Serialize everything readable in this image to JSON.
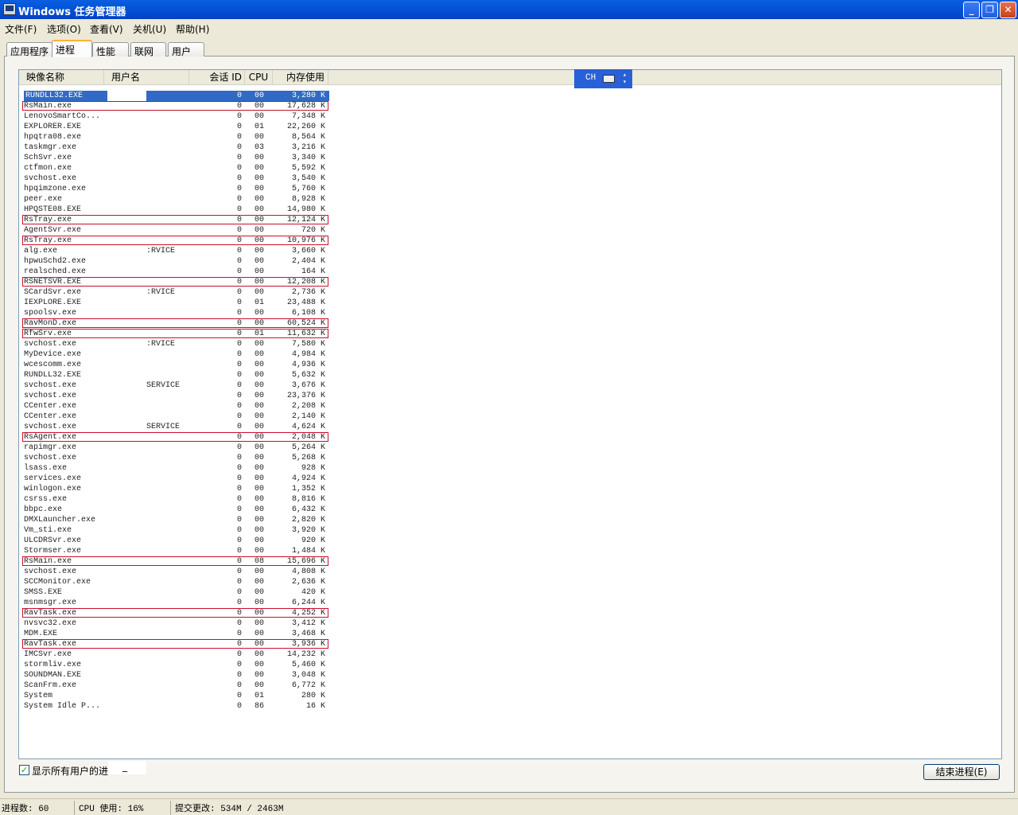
{
  "window": {
    "title": "Windows 任务管理器",
    "minimize": "_",
    "restore": "❐",
    "close": "✕"
  },
  "menu": [
    "文件(F)",
    "选项(O)",
    "查看(V)",
    "关机(U)",
    "帮助(H)"
  ],
  "tabs": [
    {
      "label": "应用程序"
    },
    {
      "label": "进程",
      "active": true
    },
    {
      "label": "性能"
    },
    {
      "label": "联网"
    },
    {
      "label": "用户"
    }
  ],
  "columns": {
    "name": "映像名称",
    "user": "用户名",
    "session": "会话 ID",
    "cpu": "CPU",
    "mem": "内存使用"
  },
  "ime": {
    "lang": "CH"
  },
  "processes": [
    {
      "name": "RUNDLL32.EXE",
      "user": "",
      "session": "0",
      "cpu": "00",
      "mem": "3,280 K",
      "selected": true
    },
    {
      "name": "RsMain.exe",
      "user": "",
      "session": "0",
      "cpu": "00",
      "mem": "17,628 K",
      "highlighted": true
    },
    {
      "name": "LenovoSmartCo...",
      "user": "",
      "session": "0",
      "cpu": "00",
      "mem": "7,348 K"
    },
    {
      "name": "EXPLORER.EXE",
      "user": "",
      "session": "0",
      "cpu": "01",
      "mem": "22,260 K"
    },
    {
      "name": "hpqtra08.exe",
      "user": "",
      "session": "0",
      "cpu": "00",
      "mem": "8,564 K"
    },
    {
      "name": "taskmgr.exe",
      "user": "",
      "session": "0",
      "cpu": "03",
      "mem": "3,216 K"
    },
    {
      "name": "SchSvr.exe",
      "user": "",
      "session": "0",
      "cpu": "00",
      "mem": "3,340 K"
    },
    {
      "name": "ctfmon.exe",
      "user": "",
      "session": "0",
      "cpu": "00",
      "mem": "5,592 K"
    },
    {
      "name": "svchost.exe",
      "user": "",
      "session": "0",
      "cpu": "00",
      "mem": "3,540 K"
    },
    {
      "name": "hpqimzone.exe",
      "user": "",
      "session": "0",
      "cpu": "00",
      "mem": "5,760 K"
    },
    {
      "name": "peer.exe",
      "user": "",
      "session": "0",
      "cpu": "00",
      "mem": "8,928 K"
    },
    {
      "name": "HPQSTE08.EXE",
      "user": "",
      "session": "0",
      "cpu": "00",
      "mem": "14,980 K"
    },
    {
      "name": "RsTray.exe",
      "user": "",
      "session": "0",
      "cpu": "00",
      "mem": "12,124 K",
      "highlighted": true
    },
    {
      "name": "AgentSvr.exe",
      "user": "",
      "session": "0",
      "cpu": "00",
      "mem": "720 K"
    },
    {
      "name": "RsTray.exe",
      "user": "",
      "session": "0",
      "cpu": "00",
      "mem": "10,976 K",
      "highlighted": true
    },
    {
      "name": "alg.exe",
      "user": ":RVICE",
      "session": "0",
      "cpu": "00",
      "mem": "3,660 K"
    },
    {
      "name": "hpwuSchd2.exe",
      "user": "",
      "session": "0",
      "cpu": "00",
      "mem": "2,404 K"
    },
    {
      "name": "realsched.exe",
      "user": "",
      "session": "0",
      "cpu": "00",
      "mem": "164 K"
    },
    {
      "name": "RSNETSVR.EXE",
      "user": "",
      "session": "0",
      "cpu": "00",
      "mem": "12,208 K",
      "highlighted": true
    },
    {
      "name": "SCardSvr.exe",
      "user": ":RVICE",
      "session": "0",
      "cpu": "00",
      "mem": "2,736 K"
    },
    {
      "name": "IEXPLORE.EXE",
      "user": "",
      "session": "0",
      "cpu": "01",
      "mem": "23,488 K"
    },
    {
      "name": "spoolsv.exe",
      "user": "",
      "session": "0",
      "cpu": "00",
      "mem": "6,108 K"
    },
    {
      "name": "RavMonD.exe",
      "user": "",
      "session": "0",
      "cpu": "00",
      "mem": "60,524 K",
      "highlighted": true
    },
    {
      "name": "RfwSrv.exe",
      "user": "",
      "session": "0",
      "cpu": "01",
      "mem": "11,632 K",
      "highlighted": true
    },
    {
      "name": "svchost.exe",
      "user": ":RVICE",
      "session": "0",
      "cpu": "00",
      "mem": "7,580 K"
    },
    {
      "name": "MyDevice.exe",
      "user": "",
      "session": "0",
      "cpu": "00",
      "mem": "4,984 K"
    },
    {
      "name": "wcescomm.exe",
      "user": "",
      "session": "0",
      "cpu": "00",
      "mem": "4,936 K"
    },
    {
      "name": "RUNDLL32.EXE",
      "user": "",
      "session": "0",
      "cpu": "00",
      "mem": "5,632 K"
    },
    {
      "name": "svchost.exe",
      "user": "SERVICE",
      "session": "0",
      "cpu": "00",
      "mem": "3,676 K"
    },
    {
      "name": "svchost.exe",
      "user": "",
      "session": "0",
      "cpu": "00",
      "mem": "23,376 K"
    },
    {
      "name": "CCenter.exe",
      "user": "",
      "session": "0",
      "cpu": "00",
      "mem": "2,208 K"
    },
    {
      "name": "CCenter.exe",
      "user": "",
      "session": "0",
      "cpu": "00",
      "mem": "2,140 K"
    },
    {
      "name": "svchost.exe",
      "user": "SERVICE",
      "session": "0",
      "cpu": "00",
      "mem": "4,624 K"
    },
    {
      "name": "RsAgent.exe",
      "user": "",
      "session": "0",
      "cpu": "00",
      "mem": "2,048 K",
      "highlighted": true
    },
    {
      "name": "rapimgr.exe",
      "user": "",
      "session": "0",
      "cpu": "00",
      "mem": "5,264 K"
    },
    {
      "name": "svchost.exe",
      "user": "",
      "session": "0",
      "cpu": "00",
      "mem": "5,268 K"
    },
    {
      "name": "lsass.exe",
      "user": "",
      "session": "0",
      "cpu": "00",
      "mem": "928 K"
    },
    {
      "name": "services.exe",
      "user": "",
      "session": "0",
      "cpu": "00",
      "mem": "4,924 K"
    },
    {
      "name": "winlogon.exe",
      "user": "",
      "session": "0",
      "cpu": "00",
      "mem": "1,352 K"
    },
    {
      "name": "csrss.exe",
      "user": "",
      "session": "0",
      "cpu": "00",
      "mem": "8,816 K"
    },
    {
      "name": "bbpc.exe",
      "user": "",
      "session": "0",
      "cpu": "00",
      "mem": "6,432 K"
    },
    {
      "name": "DMXLauncher.exe",
      "user": "",
      "session": "0",
      "cpu": "00",
      "mem": "2,820 K"
    },
    {
      "name": "Vm_sti.exe",
      "user": "",
      "session": "0",
      "cpu": "00",
      "mem": "3,920 K"
    },
    {
      "name": "ULCDRSvr.exe",
      "user": "",
      "session": "0",
      "cpu": "00",
      "mem": "920 K"
    },
    {
      "name": "Stormser.exe",
      "user": "",
      "session": "0",
      "cpu": "00",
      "mem": "1,484 K"
    },
    {
      "name": "RsMain.exe",
      "user": "",
      "session": "0",
      "cpu": "08",
      "mem": "15,696 K",
      "highlighted": true
    },
    {
      "name": "svchost.exe",
      "user": "",
      "session": "0",
      "cpu": "00",
      "mem": "4,808 K"
    },
    {
      "name": "SCCMonitor.exe",
      "user": "",
      "session": "0",
      "cpu": "00",
      "mem": "2,636 K"
    },
    {
      "name": "SMSS.EXE",
      "user": "",
      "session": "0",
      "cpu": "00",
      "mem": "420 K"
    },
    {
      "name": "msnmsgr.exe",
      "user": "",
      "session": "0",
      "cpu": "00",
      "mem": "6,244 K"
    },
    {
      "name": "RavTask.exe",
      "user": "",
      "session": "0",
      "cpu": "00",
      "mem": "4,252 K",
      "highlighted": true
    },
    {
      "name": "nvsvc32.exe",
      "user": "",
      "session": "0",
      "cpu": "00",
      "mem": "3,412 K"
    },
    {
      "name": "MDM.EXE",
      "user": "",
      "session": "0",
      "cpu": "00",
      "mem": "3,468 K"
    },
    {
      "name": "RavTask.exe",
      "user": "",
      "session": "0",
      "cpu": "00",
      "mem": "3,936 K",
      "highlighted": true
    },
    {
      "name": "IMCSvr.exe",
      "user": "",
      "session": "0",
      "cpu": "00",
      "mem": "14,232 K"
    },
    {
      "name": "stormliv.exe",
      "user": "",
      "session": "0",
      "cpu": "00",
      "mem": "5,460 K"
    },
    {
      "name": "SOUNDMAN.EXE",
      "user": "",
      "session": "0",
      "cpu": "00",
      "mem": "3,048 K"
    },
    {
      "name": "ScanFrm.exe",
      "user": "",
      "session": "0",
      "cpu": "00",
      "mem": "6,772 K"
    },
    {
      "name": "System",
      "user": "",
      "session": "0",
      "cpu": "01",
      "mem": "280 K"
    },
    {
      "name": "System Idle P...",
      "user": "",
      "session": "0",
      "cpu": "86",
      "mem": "16 K"
    }
  ],
  "show_all_label": "显示所有用户的进",
  "show_all_suffix": "_",
  "end_process_label": "结束进程(E)",
  "status": {
    "processes": "进程数: 60",
    "cpu": "CPU 使用: 16%",
    "commit": "提交更改: 534M / 2463M"
  }
}
